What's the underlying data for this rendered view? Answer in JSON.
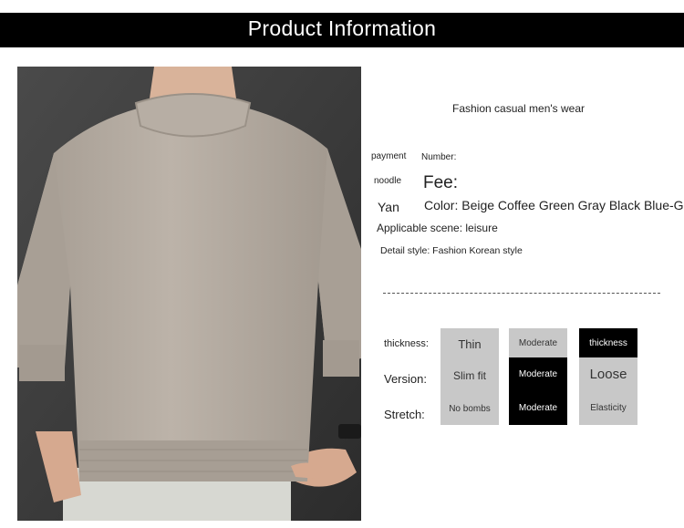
{
  "header": {
    "title": "Product Information"
  },
  "product": {
    "tagline": "Fashion casual men's wear",
    "payment_label": "payment",
    "number_label": "Number:",
    "noodle_label": "noodle",
    "fee_label": "Fee:",
    "yan_label": "Yan",
    "color_line": "Color: Beige Coffee Green Gray Black Blue-Gray",
    "scene_line": "Applicable scene: leisure",
    "style_line": "Detail style: Fashion Korean style"
  },
  "attributes": {
    "rows": [
      {
        "label": "thickness:",
        "options": [
          "Thin",
          "Moderate",
          "thickness"
        ],
        "selected": 1
      },
      {
        "label": "Version:",
        "options": [
          "Slim fit",
          "Moderate",
          "Loose"
        ],
        "selected": 1
      },
      {
        "label": "Stretch:",
        "options": [
          "No bombs",
          "Moderate",
          "Elasticity"
        ],
        "selected": 1
      }
    ]
  },
  "colors": {
    "banner": "#000000",
    "cell_gray": "#c8c8c8",
    "cell_black": "#000000",
    "sweater": "#b2a99f"
  }
}
